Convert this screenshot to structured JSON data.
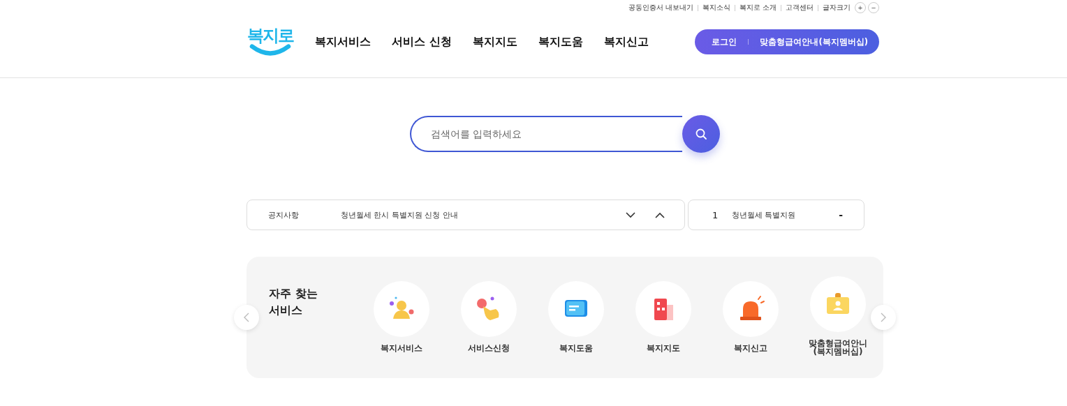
{
  "utility_links": [
    "공동인증서 내보내기",
    "복지소식",
    "복지로 소개",
    "고객센터"
  ],
  "font_size": {
    "label": "글자크기",
    "increase": "+",
    "decrease": "−"
  },
  "logo": {
    "text": "복지로"
  },
  "nav": [
    "복지서비스",
    "서비스 신청",
    "복지지도",
    "복지도움",
    "복지신고"
  ],
  "account": {
    "login": "로그인",
    "membership": "맞춤형급여안내(복지멤버십)"
  },
  "search": {
    "placeholder": "검색어를 입력하세요"
  },
  "notice": {
    "label": "공지사항",
    "title": "청년월세 한시 특별지원 신청 안내"
  },
  "ranking": {
    "rank": "1",
    "keyword": "청년월세 특별지원",
    "change": "-"
  },
  "frequent": {
    "title_lines": [
      "자주 찾는",
      "서비스"
    ],
    "services": [
      {
        "kind": "person",
        "label_lines": [
          "복지서비스"
        ]
      },
      {
        "kind": "hand",
        "label_lines": [
          "서비스신청"
        ]
      },
      {
        "kind": "chat",
        "label_lines": [
          "복지도움"
        ]
      },
      {
        "kind": "building",
        "label_lines": [
          "복지지도"
        ]
      },
      {
        "kind": "siren",
        "label_lines": [
          "복지신고"
        ]
      },
      {
        "kind": "badge",
        "label_lines": [
          "맞춤형급여안니",
          "(복지멤버십)"
        ]
      }
    ]
  }
}
